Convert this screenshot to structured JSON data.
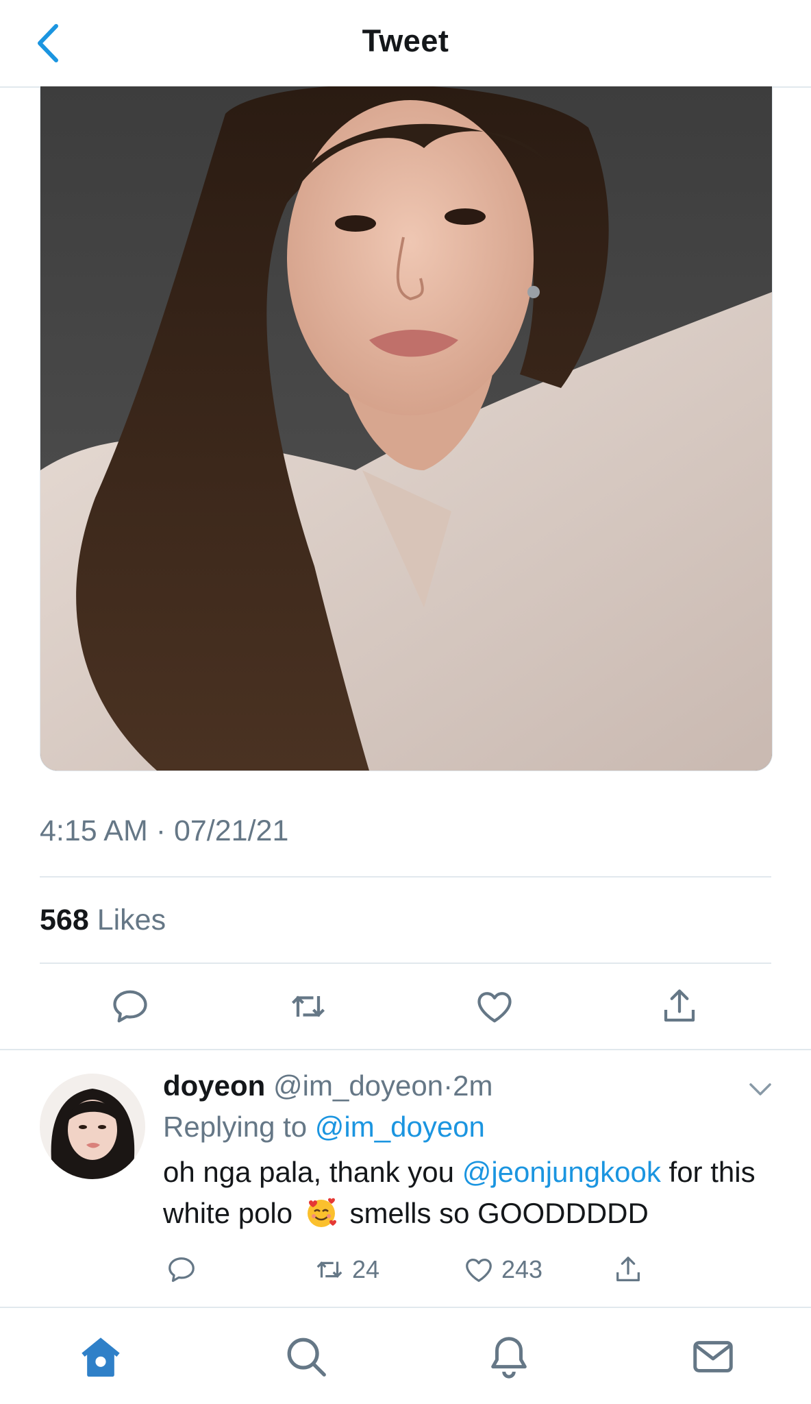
{
  "header": {
    "title": "Tweet"
  },
  "tweet": {
    "timestamp": "4:15 AM · 07/21/21",
    "likes_count": "568",
    "likes_label": "Likes"
  },
  "reply": {
    "name": "doyeon",
    "handle": "@im_doyeon",
    "separator": "·",
    "time": "2m",
    "replying_prefix": "Replying to",
    "replying_to": "@im_doyeon",
    "text_1": "oh nga pala, thank you",
    "mention": "@jeonjungkook",
    "text_2": "for this white polo",
    "text_3": "smells so GOODDDDD",
    "emoji": "smiling-face-with-hearts",
    "retweets": "24",
    "likes": "243"
  },
  "colors": {
    "accent": "#1b95e0",
    "secondary_text": "#657786",
    "divider": "#e1e8ed",
    "tab_active": "#2f80c8"
  },
  "tabs": [
    "home-icon",
    "search-icon",
    "notifications-icon",
    "messages-icon"
  ]
}
